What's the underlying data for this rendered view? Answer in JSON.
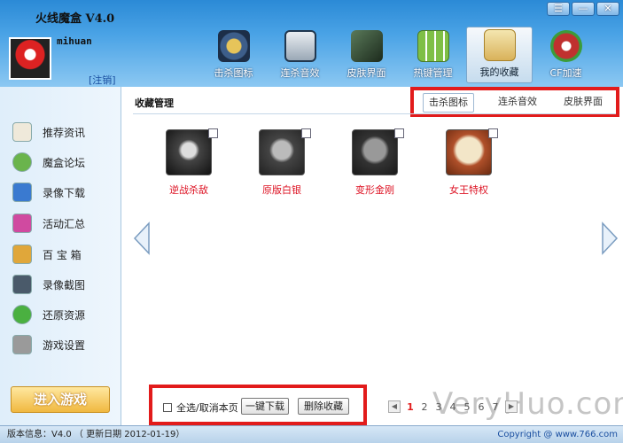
{
  "app": {
    "title": "火线魔盒 V4.0",
    "window_controls": [
      "☰",
      "—",
      "✕"
    ]
  },
  "user": {
    "name": "mihuan",
    "logout_label": "[注销]"
  },
  "nav": [
    {
      "label": "击杀图标",
      "icon": "kill-icon-icon",
      "color": "#3d5e8a"
    },
    {
      "label": "连杀音效",
      "icon": "audio-meter-icon",
      "color": "#20374f"
    },
    {
      "label": "皮肤界面",
      "icon": "skin-icon",
      "color": "#2c4030"
    },
    {
      "label": "热键管理",
      "icon": "hotkey-icon",
      "color": "#7fbf46"
    },
    {
      "label": "我的收藏",
      "icon": "favorites-icon",
      "color": "#d9b25a",
      "active": true
    },
    {
      "label": "CF加速",
      "icon": "cf-accelerate-icon",
      "color": "#c0312f"
    }
  ],
  "sidebar": {
    "items": [
      {
        "label": "推荐资讯",
        "icon": "news-icon",
        "color": "#e8e2d0"
      },
      {
        "label": "魔盒论坛",
        "icon": "forum-icon",
        "color": "#6ab44c"
      },
      {
        "label": "录像下载",
        "icon": "download-icon",
        "color": "#3a7ad0"
      },
      {
        "label": "活动汇总",
        "icon": "gift-icon",
        "color": "#d04aa0"
      },
      {
        "label": "百 宝 箱",
        "icon": "treasure-box-icon",
        "color": "#e0a73a"
      },
      {
        "label": "录像截图",
        "icon": "screenshot-icon",
        "color": "#4a5a6a"
      },
      {
        "label": "还原资源",
        "icon": "restore-icon",
        "color": "#4ab040"
      },
      {
        "label": "游戏设置",
        "icon": "settings-tools-icon",
        "color": "#8a8a8a"
      }
    ],
    "enter_game_label": "进入游戏"
  },
  "main": {
    "title": "收藏管理",
    "tabs": [
      {
        "label": "击杀图标",
        "active": true
      },
      {
        "label": "连杀音效",
        "active": false
      },
      {
        "label": "皮肤界面",
        "active": false
      }
    ],
    "items": [
      {
        "label": "逆战杀敌",
        "icon": "skull-star-badge-icon",
        "color": "#333"
      },
      {
        "label": "原版白银",
        "icon": "silver-skull-badge-icon",
        "color": "#444"
      },
      {
        "label": "变形金刚",
        "icon": "transformers-badge-icon",
        "color": "#3a3a3a"
      },
      {
        "label": "女王特权",
        "icon": "queen-privilege-badge-icon",
        "color": "#b0502a"
      }
    ],
    "select_all_label": "全选/取消本页",
    "download_label": "一键下载",
    "delete_label": "删除收藏",
    "pager": {
      "pages": [
        "1",
        "2",
        "3",
        "4",
        "5",
        "6",
        "7"
      ],
      "current": "1"
    },
    "watermark": "VeryHuo.com"
  },
  "status": {
    "version_label": "版本信息：V4.0 （ 更新日期 2012-01-19）",
    "copyright": "Copyright @ www.766.com"
  }
}
